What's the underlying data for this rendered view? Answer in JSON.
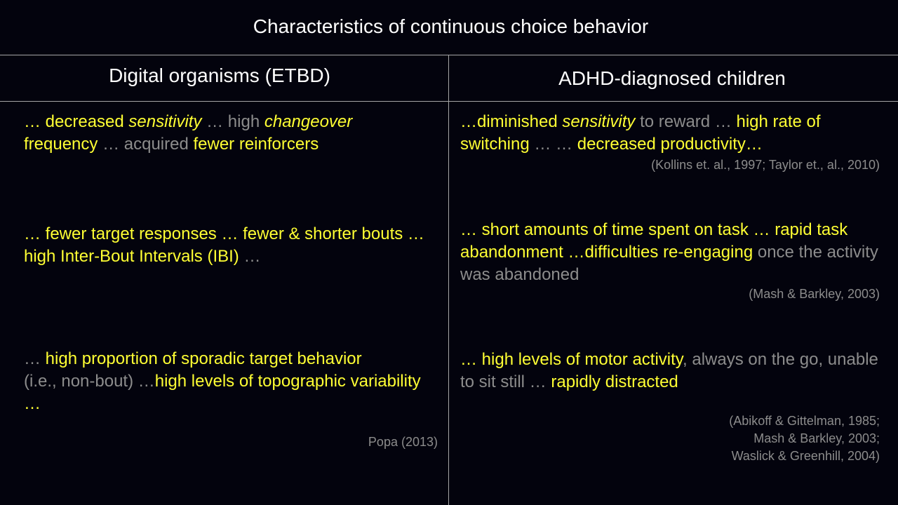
{
  "title": "Characteristics of continuous choice behavior",
  "left_header": "Digital organisms (ETBD)",
  "right_header": "ADHD-diagnosed children",
  "left": {
    "b1": {
      "s1": "… decreased ",
      "s2": "sensitivity",
      "s3": " … high ",
      "s4": "changeover",
      "s5": "frequency",
      "s6": " … acquired ",
      "s7": "fewer reinforcers"
    },
    "b2": {
      "s1": "… fewer target responses … fewer & shorter bouts … high Inter-Bout Intervals (IBI) ",
      "s2": "…"
    },
    "b3": {
      "s1": "… ",
      "s2": "high proportion of sporadic target behavior",
      "s3": "(i.e., non-bout) …",
      "s4": "high levels of topographic variability …"
    },
    "citation": "Popa (2013)"
  },
  "right": {
    "b1": {
      "s1": "…diminished ",
      "s2": "sensitivity",
      "s3": " to reward … ",
      "s4": "high rate of switching",
      "s5": " … … ",
      "s6": "decreased productivity…"
    },
    "c1": "(Kollins et. al., 1997; Taylor et., al., 2010)",
    "b2": {
      "s1": "… short amounts of time spent on task … rapid task abandonment …difficulties re-engaging",
      "s2": " once the activity was abandoned"
    },
    "c2": "(Mash & Barkley, 2003)",
    "b3": {
      "s1": "… high levels of motor activity",
      "s2": ", always on the go, unable to sit still … ",
      "s3": "rapidly distracted"
    },
    "c3": {
      "l1": "(Abikoff & Gittelman, 1985;",
      "l2": "Mash & Barkley, 2003;",
      "l3": "Waslick & Greenhill, 2004)"
    }
  }
}
